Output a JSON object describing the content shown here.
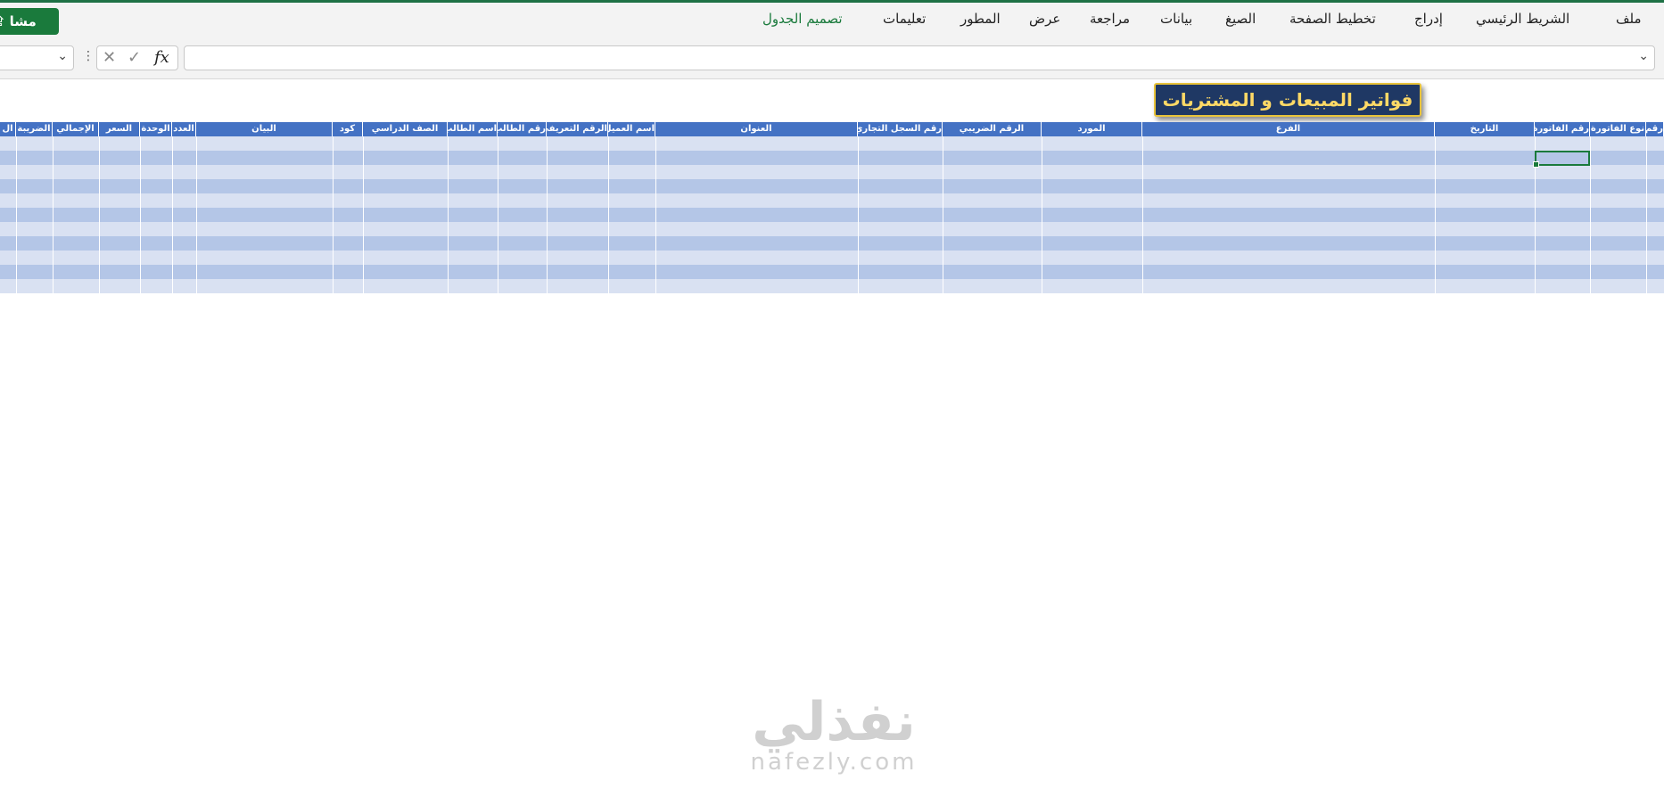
{
  "ribbon": {
    "tabs": [
      {
        "label": "ملف",
        "active": false
      },
      {
        "label": "الشريط الرئيسي",
        "active": false
      },
      {
        "label": "إدراج",
        "active": false
      },
      {
        "label": "تخطيط الصفحة",
        "active": false
      },
      {
        "label": "الصيغ",
        "active": false
      },
      {
        "label": "بيانات",
        "active": false
      },
      {
        "label": "مراجعة",
        "active": false
      },
      {
        "label": "عرض",
        "active": false
      },
      {
        "label": "المطور",
        "active": false
      },
      {
        "label": "تعليمات",
        "active": false
      },
      {
        "label": "تصميم الجدول",
        "active": true
      }
    ],
    "share_label": "مشا"
  },
  "formula_bar": {
    "fx_label": "fx",
    "value": ""
  },
  "sheet": {
    "title": "فواتير المبيعات و المشتريات",
    "headers": [
      "رقم",
      "نوع الفاتورة",
      "رقم الفاتورة",
      "التاريخ",
      "الفرع",
      "المورد",
      "الرقم الضريبي",
      "رقم السجل التجاري",
      "العنوان",
      "اسم العميل",
      "الرقم التعريفي",
      "رقم الطالب",
      "اسم الطالب",
      "الصف الدراسي",
      "كود",
      "البيان",
      "العدد",
      "الوحدة",
      "السعر",
      "الإجمالي",
      "الضريبة",
      "ال"
    ]
  },
  "watermark": {
    "arabic": "نفذلي",
    "latin": "nafezly.com"
  },
  "colors": {
    "accent": "#1a7a3c",
    "header_fill": "#4472c4",
    "band_light": "#d9e1f2",
    "band_dark": "#b4c6e7",
    "title_fill": "#1f3864",
    "title_text": "#ffd966"
  }
}
